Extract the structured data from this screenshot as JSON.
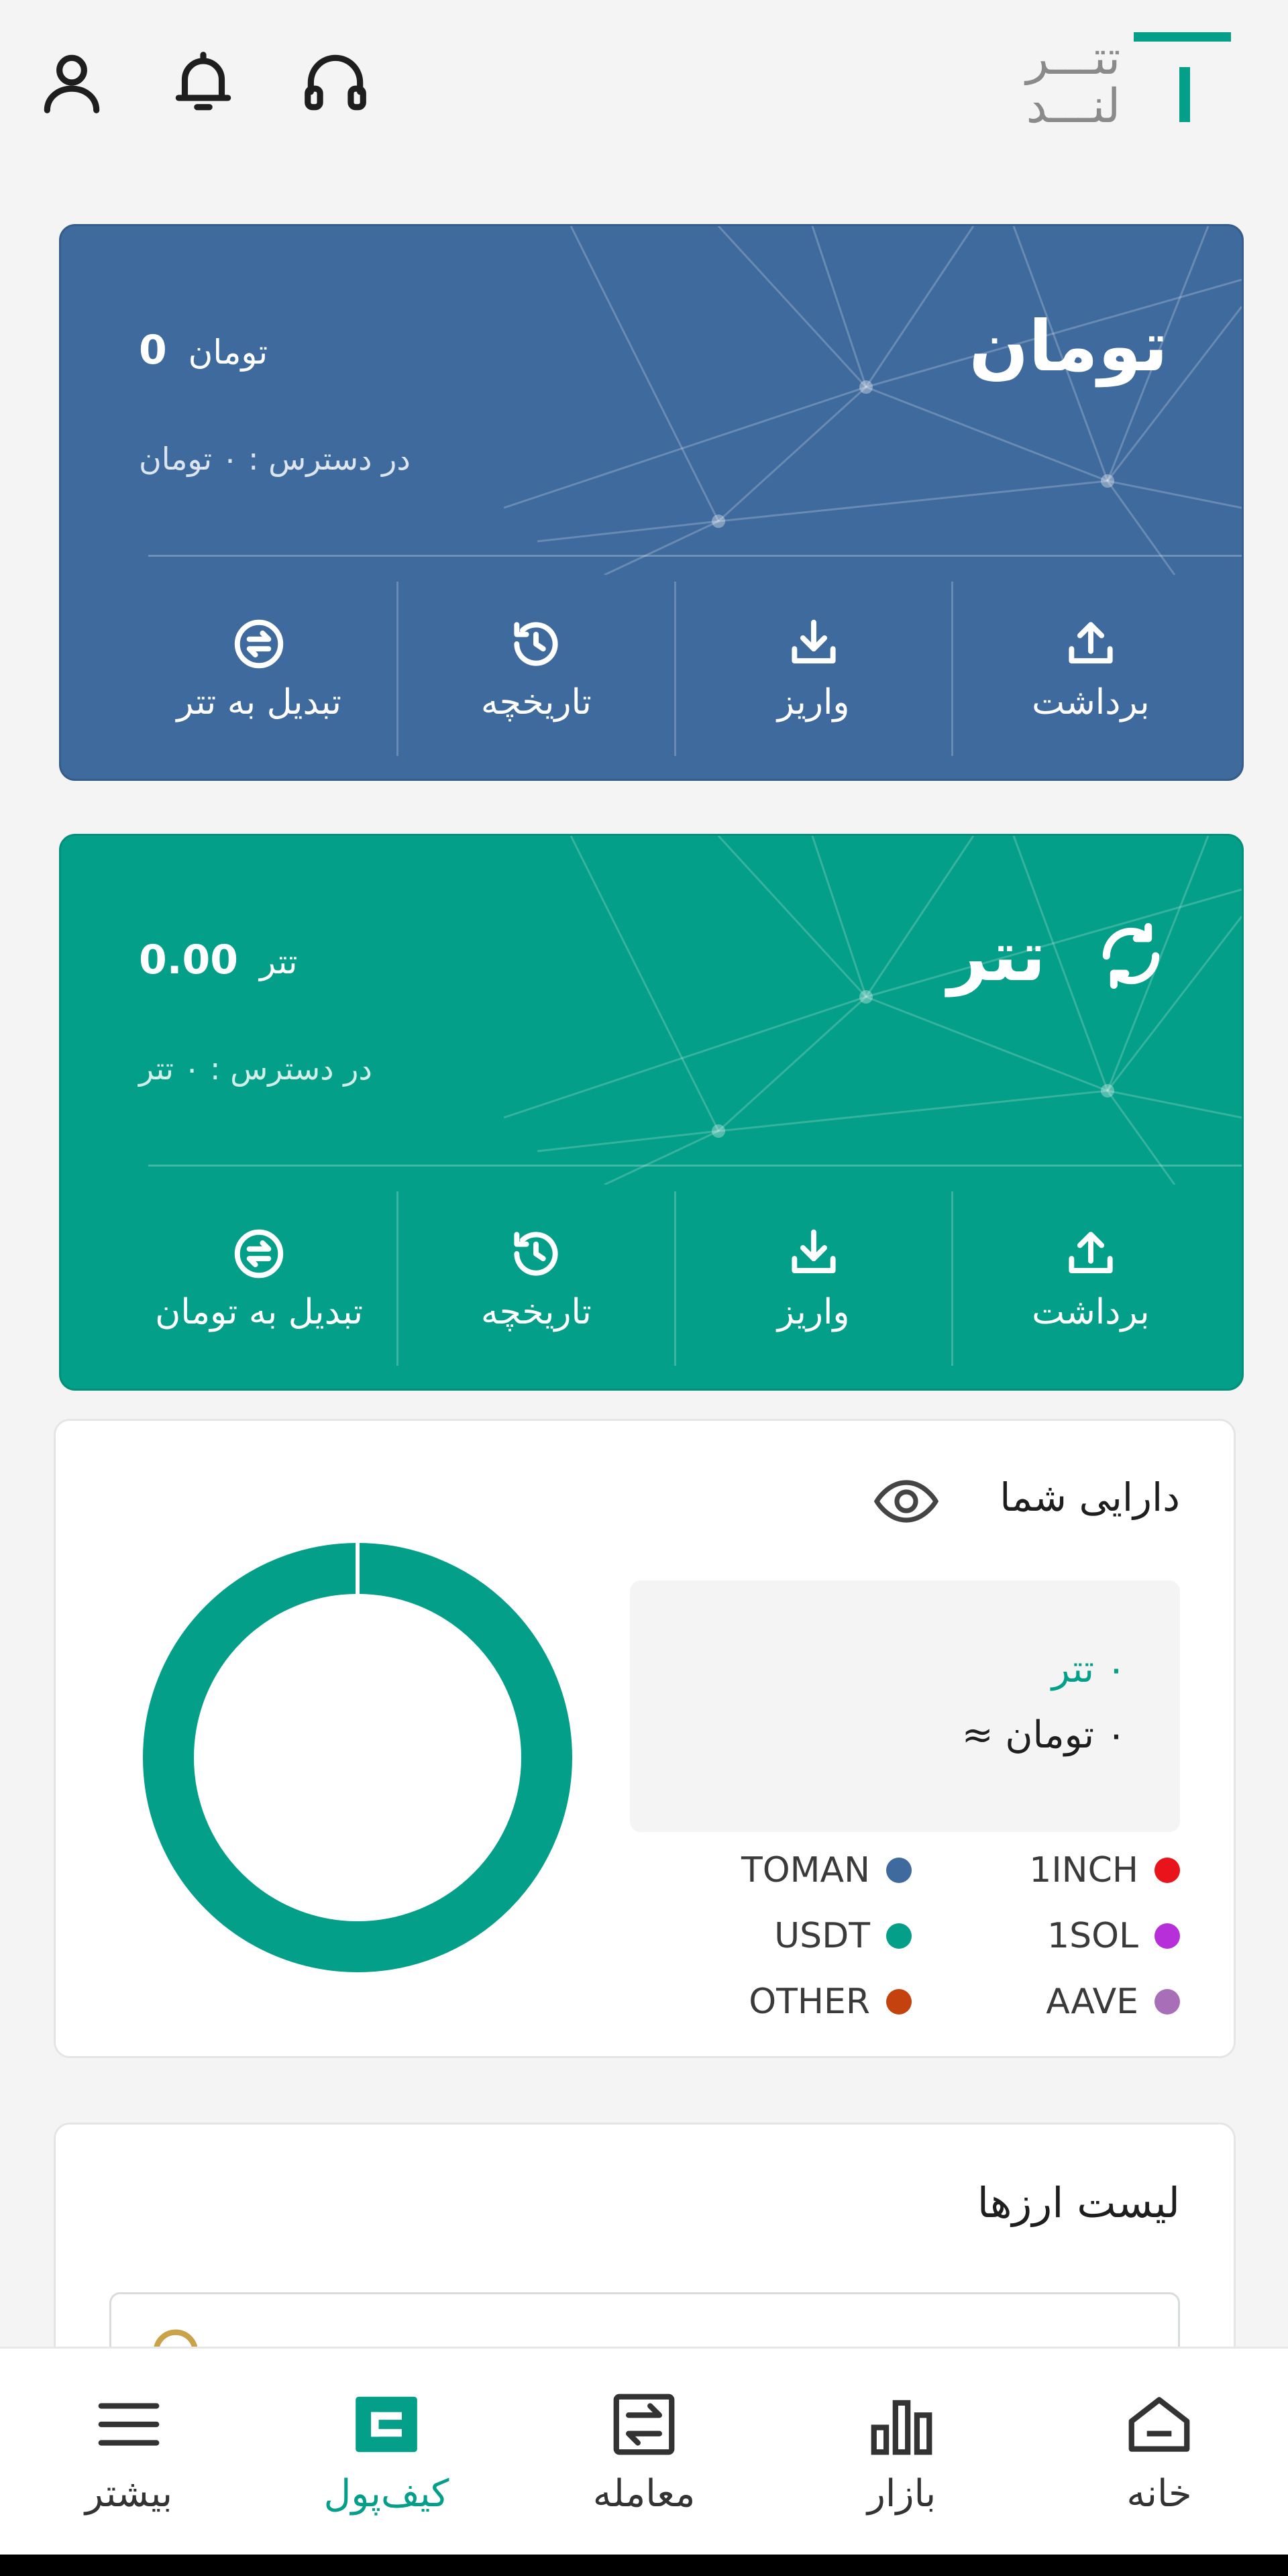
{
  "app": {
    "logo_text_top": "تتـــر",
    "logo_text_bottom": "لنـــد",
    "brand_color": "#049f88"
  },
  "header_icons": [
    "headset-icon",
    "bell-icon",
    "user-icon"
  ],
  "toman_card": {
    "title": "تومان",
    "balance_value": "0",
    "balance_unit": "تومان",
    "available": "در دسترس : ۰ تومان",
    "color": "#3f6a9d",
    "actions": [
      {
        "label": "برداشت",
        "icon": "upload-icon"
      },
      {
        "label": "واریز",
        "icon": "download-icon"
      },
      {
        "label": "تاریخچه",
        "icon": "history-icon"
      },
      {
        "label": "تبدیل به تتر",
        "icon": "exchange-icon"
      }
    ]
  },
  "tether_card": {
    "title": "تتر",
    "balance_value": "0.00",
    "balance_unit": "تتر",
    "available": "در دسترس : ۰ تتر",
    "color": "#049f88",
    "actions": [
      {
        "label": "برداشت",
        "icon": "upload-icon"
      },
      {
        "label": "واریز",
        "icon": "download-icon"
      },
      {
        "label": "تاریخچه",
        "icon": "history-icon"
      },
      {
        "label": "تبدیل به تومان",
        "icon": "exchange-icon"
      }
    ]
  },
  "assets": {
    "title": "دارایی شما",
    "usdt_amount": "۰ تتر",
    "toman_amount": "۰ تومان ≈",
    "legend": [
      {
        "label": "1INCH",
        "color": "#e8131b"
      },
      {
        "label": "TOMAN",
        "color": "#3f6a9d"
      },
      {
        "label": "1SOL",
        "color": "#b62fd8"
      },
      {
        "label": "USDT",
        "color": "#049f88"
      },
      {
        "label": "AAVE",
        "color": "#a86fb8"
      },
      {
        "label": "OTHER",
        "color": "#c4420e"
      }
    ]
  },
  "currency_list": {
    "title": "لیست ارزها"
  },
  "bottom_nav": [
    {
      "label": "خانه",
      "icon": "home-icon",
      "active": false
    },
    {
      "label": "بازار",
      "icon": "bar-chart-icon",
      "active": false
    },
    {
      "label": "معامله",
      "icon": "trade-icon",
      "active": false
    },
    {
      "label": "کیف‌پول",
      "icon": "wallet-icon",
      "active": true
    },
    {
      "label": "بیشتر",
      "icon": "menu-icon",
      "active": false
    }
  ]
}
